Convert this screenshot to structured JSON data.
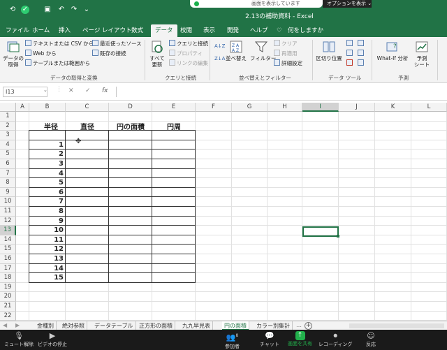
{
  "window": {
    "title": "2.13の補助資料 - Excel",
    "share_banner": "画面を表示しています",
    "option_button": "オプションを表示 ⌄"
  },
  "tabs": [
    "ファイル",
    "ホーム",
    "挿入",
    "ページ レイアウト",
    "数式",
    "データ",
    "校閲",
    "表示",
    "開発",
    "ヘルプ",
    "何をしますか"
  ],
  "active_tab": "データ",
  "ribbon": {
    "get_data": "データの\n取得",
    "text_csv": "テキストまたは CSV から",
    "web": "Web から",
    "table_range": "テーブルまたは範囲から",
    "recent_sources": "最近使ったソース",
    "existing_conn": "既存の接続",
    "group_get_data": "データの取得と変換",
    "refresh_all": "すべて\n更新",
    "queries_conn": "クエリと接続",
    "properties": "プロパティ",
    "edit_links": "リンクの編集",
    "group_queries": "クエリと接続",
    "sort": "並べ替え",
    "filter": "フィルター",
    "clear": "クリア",
    "reapply": "再適用",
    "advanced": "詳細設定",
    "group_sort": "並べ替えとフィルター",
    "text_to_cols": "区切り位置",
    "group_tools": "データ ツール",
    "whatif": "What-If 分析",
    "forecast_sheet": "予測\nシート",
    "group_forecast": "予測"
  },
  "formula_bar": {
    "name_box": "I13",
    "cancel": "✕",
    "enter": "✓",
    "fx": "fx",
    "value": ""
  },
  "grid": {
    "columns": [
      "A",
      "B",
      "C",
      "D",
      "E",
      "F",
      "G",
      "H",
      "I",
      "J",
      "K",
      "L"
    ],
    "rows": [
      "1",
      "2",
      "3",
      "4",
      "5",
      "6",
      "7",
      "8",
      "9",
      "10",
      "11",
      "12",
      "13",
      "14",
      "15",
      "16",
      "17",
      "18",
      "19",
      "20",
      "21",
      "22"
    ],
    "selected_column": "I",
    "selected_row": "13",
    "table_headers": [
      "半径",
      "直径",
      "円の面積",
      "円周"
    ],
    "radius_values": [
      "1",
      "2",
      "3",
      "4",
      "5",
      "6",
      "7",
      "8",
      "9",
      "10",
      "11",
      "12",
      "13",
      "14",
      "15"
    ]
  },
  "sheets": [
    "金種別",
    "絶対参照",
    "データテーブル",
    "正方形の面積",
    "九九早見表",
    "円の面積",
    "カラー別集計"
  ],
  "active_sheet": "円の面積",
  "zoom_bar": {
    "mute": "ミュート解除",
    "video": "ビデオの停止",
    "participants": "参加者",
    "participant_count": "8",
    "chat": "チャット",
    "share": "画面を共有",
    "record": "レコーディング",
    "reactions": "反応"
  }
}
